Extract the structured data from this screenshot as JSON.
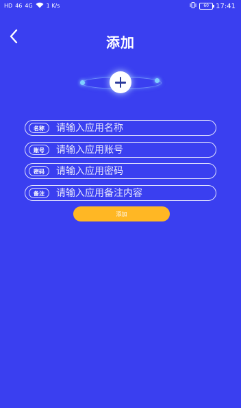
{
  "status_bar": {
    "left_glyphs": [
      "HD",
      "46",
      "4G",
      "Wi-Fi"
    ],
    "net_speed": "1",
    "net_unit": "K/s",
    "battery": "60",
    "time": "17:41"
  },
  "header": {
    "title": "添加"
  },
  "form": {
    "fields": [
      {
        "label": "名称",
        "placeholder": "请输入应用名称"
      },
      {
        "label": "账号",
        "placeholder": "请输入应用账号"
      },
      {
        "label": "密码",
        "placeholder": "请输入应用密码"
      },
      {
        "label": "备注",
        "placeholder": "请输入应用备注内容"
      }
    ],
    "submit_label": "添加"
  },
  "colors": {
    "background": "#3a3ff0",
    "accent_button": "#ffb724",
    "text": "#ffffff"
  }
}
